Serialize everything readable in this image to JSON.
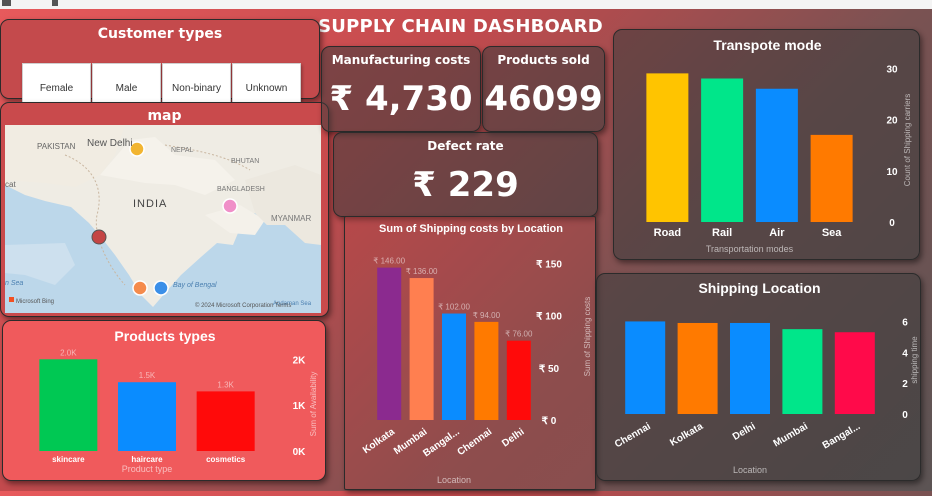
{
  "dashboard_title": "SUPPLY CHAIN DASHBOARD",
  "customer_types": {
    "title": "Customer types",
    "options": [
      "Female",
      "Male",
      "Non-binary",
      "Unknown"
    ]
  },
  "kpis": {
    "manufacturing": {
      "title": "Manufacturing costs",
      "value": "₹ 4,730"
    },
    "products_sold": {
      "title": "Products sold",
      "value": "46099"
    },
    "defect_rate": {
      "title": "Defect rate",
      "value": "₹ 229"
    }
  },
  "map": {
    "title": "map",
    "labels": {
      "pakistan": "PAKISTAN",
      "new_delhi": "New Delhi",
      "nepal": "NEPAL",
      "bhutan": "BHUTAN",
      "india": "INDIA",
      "bangladesh": "BANGLADESH",
      "myanmar": "MYANMAR",
      "bay": "Bay of Bengal",
      "sea_left": "n Sea",
      "sea_right": "Andaman Sea",
      "cat": "cat",
      "bing": "Microsoft Bing",
      "copyright": "© 2024 Microsoft Corporation Terms"
    },
    "pin_colors": {
      "delhi": "#f2b531",
      "kolkata": "#f08fc8",
      "mumbai": "#c44545",
      "bangalore": "#f58b4c",
      "chennai": "#3b8fe8"
    }
  },
  "chart_data": [
    {
      "id": "transport",
      "type": "bar",
      "title": "Transpote mode",
      "xlabel": "Transportation modes",
      "ylabel": "Count of Shipping carriers",
      "categories": [
        "Road",
        "Rail",
        "Air",
        "Sea"
      ],
      "values": [
        29,
        28,
        26,
        17
      ],
      "colors": [
        "#ffc400",
        "#00e68a",
        "#0a8cff",
        "#ff7a00"
      ],
      "yticks": [
        0,
        10,
        20,
        30
      ],
      "ylim": [
        0,
        32
      ]
    },
    {
      "id": "shipping_cost",
      "type": "bar",
      "title": "Sum of Shipping costs by Location",
      "xlabel": "Location",
      "ylabel": "Sum of Shipping costs",
      "categories": [
        "Kolkata",
        "Mumbai",
        "Bangal...",
        "Chennai",
        "Delhi"
      ],
      "values": [
        146.0,
        136.0,
        102.0,
        94.0,
        76.0
      ],
      "data_labels": [
        "₹ 146.00",
        "₹ 136.00",
        "₹ 102.00",
        "₹ 94.00",
        "₹ 76.00"
      ],
      "colors": [
        "#8b2a8f",
        "#ff7f50",
        "#0a8cff",
        "#ff7a00",
        "#ff0a0a"
      ],
      "yticks": [
        "₹ 0",
        "₹ 50",
        "₹ 100",
        "₹ 150"
      ],
      "ytick_values": [
        0,
        50,
        100,
        150
      ],
      "ylim": [
        0,
        160
      ]
    },
    {
      "id": "shipping_location",
      "type": "bar",
      "title": "Shipping Location",
      "xlabel": "Location",
      "ylabel": "shipping time",
      "categories": [
        "Chennai",
        "Kolkata",
        "Delhi",
        "Mumbai",
        "Bangal..."
      ],
      "values": [
        6.0,
        5.9,
        5.9,
        5.5,
        5.3
      ],
      "colors": [
        "#0a8cff",
        "#ff7a00",
        "#0a8cff",
        "#00e68a",
        "#ff0a4a"
      ],
      "yticks": [
        0,
        2,
        4,
        6
      ],
      "ylim": [
        0,
        7
      ]
    },
    {
      "id": "products",
      "type": "bar",
      "title": "Products types",
      "xlabel": "Product type",
      "ylabel": "Sum of Availability",
      "categories": [
        "skincare",
        "haircare",
        "cosmetics"
      ],
      "values": [
        2000,
        1500,
        1300
      ],
      "data_labels": [
        "2.0K",
        "1.5K",
        "1.3K"
      ],
      "colors": [
        "#00c853",
        "#0a8cff",
        "#ff0a0a"
      ],
      "yticks": [
        "0K",
        "1K",
        "2K"
      ],
      "ytick_values": [
        0,
        1000,
        2000
      ],
      "ylim": [
        0,
        2050
      ]
    }
  ]
}
